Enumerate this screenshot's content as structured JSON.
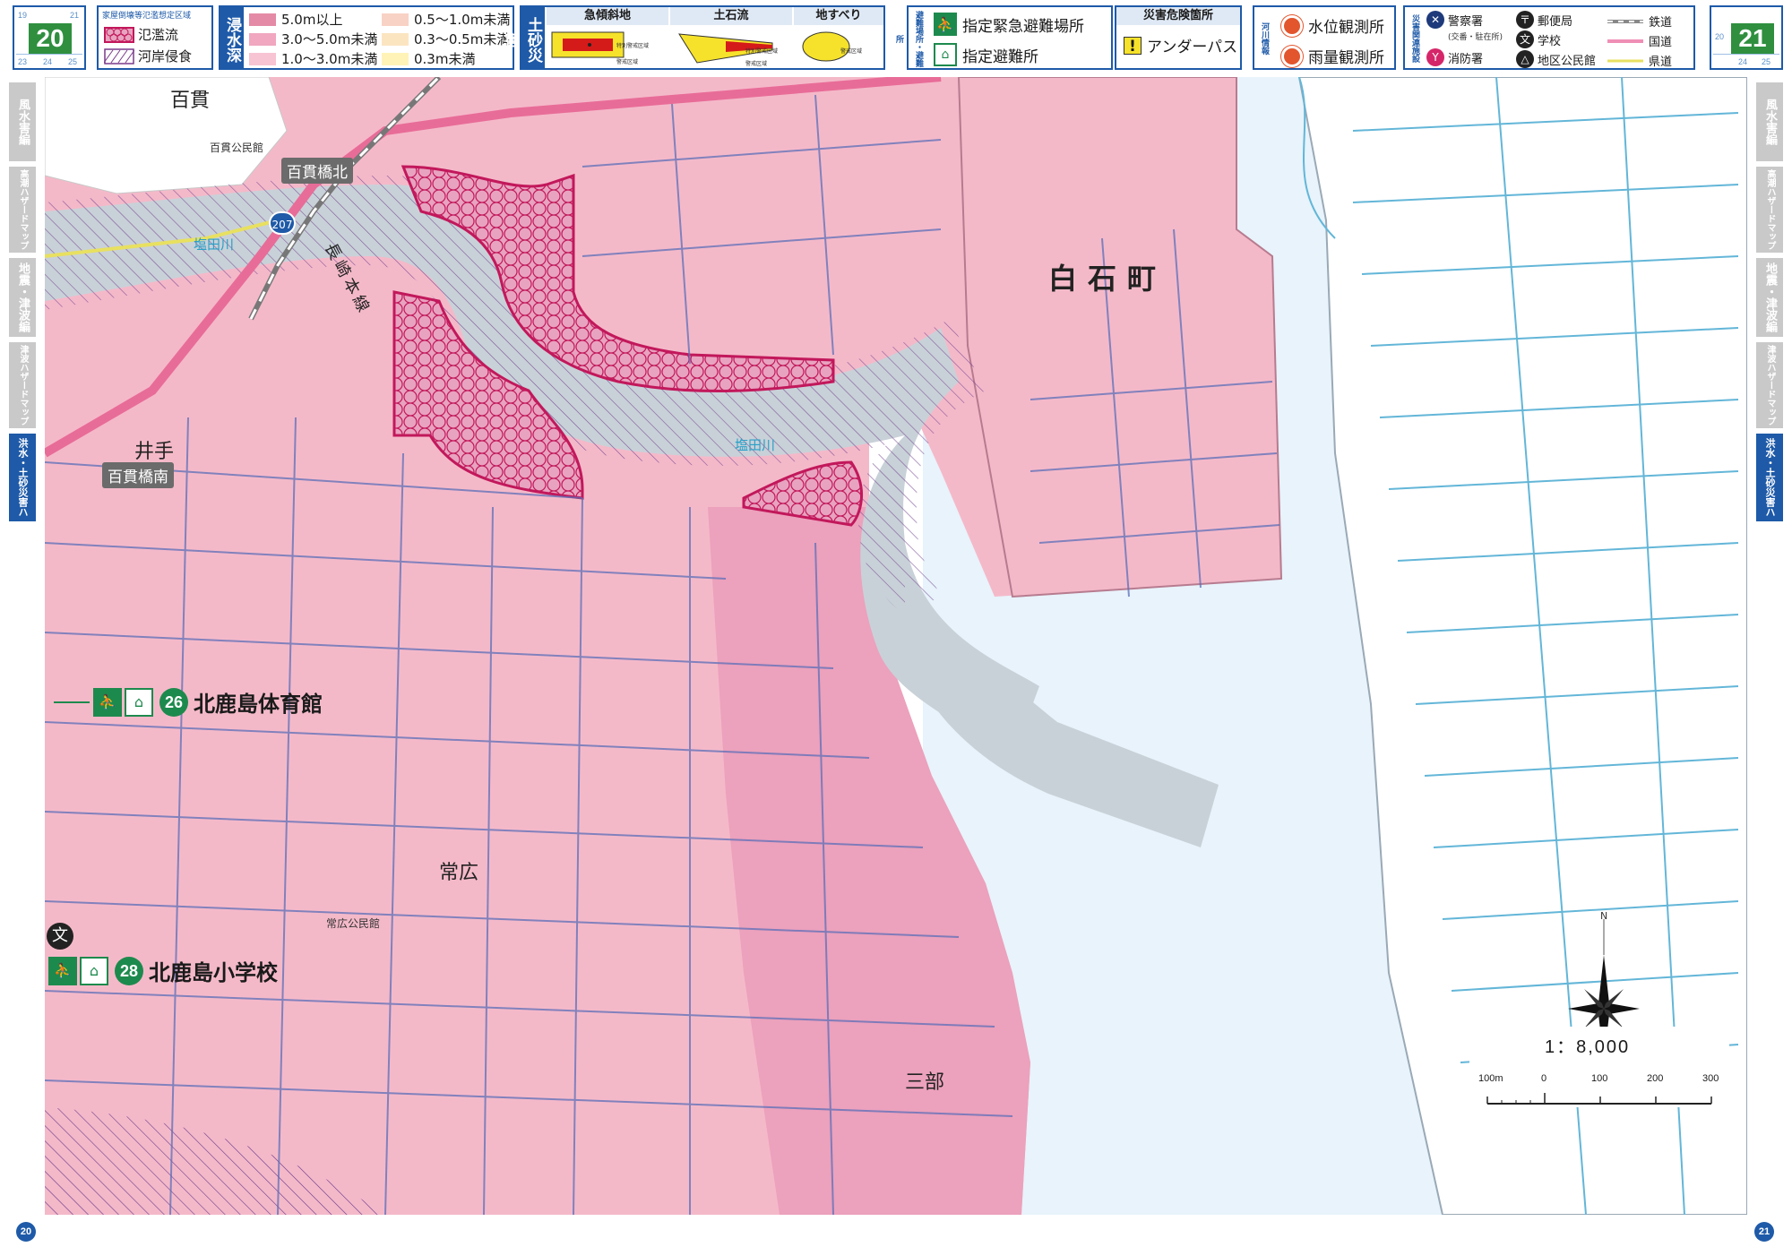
{
  "pages": {
    "left": {
      "number": "20",
      "nav": [
        "19",
        "21",
        "23",
        "24",
        "25"
      ]
    },
    "right": {
      "number": "21",
      "nav": [
        "20",
        "24",
        "25"
      ]
    },
    "footer_left": "20",
    "footer_right": "21"
  },
  "legend": {
    "flood_houses": {
      "title": "家屋倒壊等氾濫想定区域",
      "items": [
        "氾濫流",
        "河岸侵食"
      ]
    },
    "inundation": {
      "title": "浸水深",
      "items": [
        "5.0m以上",
        "3.0～5.0m未満",
        "1.0～3.0m未満",
        "0.5～1.0m未満",
        "0.3～0.5m未満",
        "0.3m未満"
      ],
      "colors": [
        "#e48aa6",
        "#f0a7bf",
        "#f7c4d3",
        "#f8d2c4",
        "#fbe5c1",
        "#fff3b8"
      ]
    },
    "landslide": {
      "title": "土砂災害",
      "heads": [
        "急傾斜地",
        "土石流",
        "地すべり"
      ],
      "small": [
        "特別警戒区域",
        "警戒区域",
        "特別警戒区域",
        "警戒区域",
        "警戒区域"
      ]
    },
    "evacuation": {
      "title": "避難場所・避難所",
      "items": [
        "指定緊急避難場所",
        "指定避難所"
      ]
    },
    "danger": {
      "title": "災害危険箇所",
      "items": [
        "アンダーパス"
      ]
    },
    "river_info": {
      "title": "河川情報",
      "items": [
        "水位観測所",
        "雨量観測所"
      ]
    },
    "facilities": {
      "title": "災害関連施設",
      "items": [
        "警察署",
        "(交番・駐在所)",
        "郵便局",
        "消防署",
        "学校",
        "地区公民館"
      ],
      "lines": [
        "鉄道",
        "国道",
        "県道"
      ]
    }
  },
  "side_tabs": {
    "left": [
      "風水害編",
      "高潮ハザードマップ",
      "地震・津波編",
      "津波ハザードマップ",
      "洪水・土砂災害ハザードマップ"
    ],
    "right": [
      "風水害編",
      "高潮ハザードマップ",
      "地震・津波編",
      "津波ハザードマップ",
      "洪水・土砂災害ハザードマップ"
    ]
  },
  "map": {
    "places": [
      "百貫",
      "井手",
      "常広",
      "三部",
      "白石町"
    ],
    "rivers": [
      "塩田川",
      "塩田川"
    ],
    "railway": "長崎本線",
    "stations": [
      "百貫橋北",
      "百貫橋南"
    ],
    "route": "207",
    "facility_labels": [
      "百貫公民館",
      "常広公民館"
    ],
    "shelters": [
      {
        "no": "26",
        "name": "北鹿島体育館"
      },
      {
        "no": "28",
        "name": "北鹿島小学校"
      }
    ],
    "compass": "N",
    "scale": {
      "ratio": "1：8,000",
      "labels": [
        "100m",
        "0",
        "100",
        "200",
        "300"
      ]
    }
  },
  "colors": {
    "accent": "#1e5aa8",
    "inundation_main": "#f4b9c9",
    "inundation_deep": "#eca1bc",
    "flood_flow": "#d4257a",
    "water": "#e8f3fb",
    "river_water": "#c9d1d8",
    "shelter_green": "#1d8a4d"
  }
}
